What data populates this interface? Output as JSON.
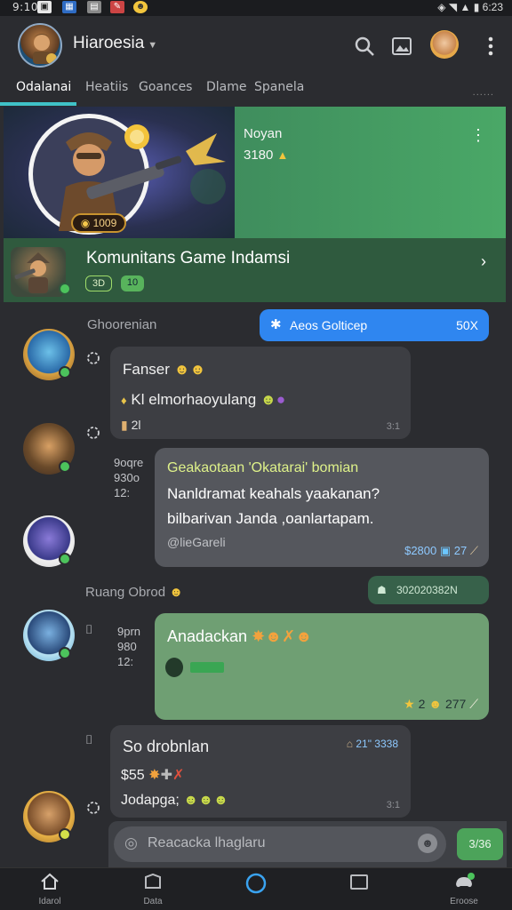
{
  "status_bar": {
    "time": "9:10",
    "right_text": "6:23",
    "icons": [
      "gallery-icon",
      "grid-icon",
      "notification-icon",
      "emoji-icon",
      "location-icon",
      "wifi-icon",
      "signal-icon",
      "battery-icon"
    ]
  },
  "app_bar": {
    "title": "Hiaroesia",
    "icons": [
      "search-icon",
      "image-icon",
      "profile-avatar",
      "more-vert-icon"
    ]
  },
  "tabs": [
    {
      "label": "Odalanai",
      "active": true
    },
    {
      "label": "Heatiis",
      "active": false
    },
    {
      "label": "Goances",
      "active": false
    },
    {
      "label": "Dlame",
      "active": false
    },
    {
      "label": "Spanela",
      "active": false
    }
  ],
  "tabs_more": "......",
  "banner": {
    "name": "Noyan",
    "count": "3180",
    "badge": "1009"
  },
  "community": {
    "title": "Komunitans Game Indamsi",
    "pill_1": "3D",
    "pill_2": "10"
  },
  "chat": {
    "section_1": "Ghoorenian",
    "chip_blue": {
      "label": "Aeos Golticep",
      "count": "50X"
    },
    "msg_1": {
      "title": "Fanser",
      "line_1": "Kl elmorhaoyulang",
      "line_2": "2l",
      "time": "3:1"
    },
    "msg_2": {
      "side_meta": [
        "9oqre",
        "930o",
        "12:"
      ],
      "title": "Geakaotaan 'Okatarai' bomian",
      "line_1": "Nanldramat keahals yaakanan?",
      "line_2": "bilbarivan Janda ,oanlartapam.",
      "line_3": "@lieGareli",
      "price": "$2800",
      "count": "27"
    },
    "section_2": "Ruang Obrod",
    "chip_green": "302020382N",
    "msg_3": {
      "side_meta": [
        "9prn",
        "980",
        "12:"
      ],
      "title": "Anadackan",
      "stars": "2",
      "count": "277"
    },
    "msg_4": {
      "title": "So drobnlan",
      "meta": "21\" 3338",
      "line_1": "$55",
      "line_2": "Jodapga;",
      "time": "3:1"
    }
  },
  "composer": {
    "placeholder": "Reacacka lhaglaru",
    "send_label": "3/36"
  },
  "bottom_nav": [
    {
      "label": "Idarol",
      "icon": "home-icon"
    },
    {
      "label": "Data",
      "icon": "folder-icon"
    },
    {
      "label": "",
      "icon": "circle-icon"
    },
    {
      "label": "",
      "icon": "tablet-icon"
    },
    {
      "label": "Eroose",
      "icon": "gamepad-icon"
    }
  ],
  "colors": {
    "accent_teal": "#3fc2c8",
    "community_green": "#2f5a3e",
    "banner_green": "#4aa867",
    "chip_blue": "#2f86f0",
    "bubble_green": "#6f9f73"
  }
}
